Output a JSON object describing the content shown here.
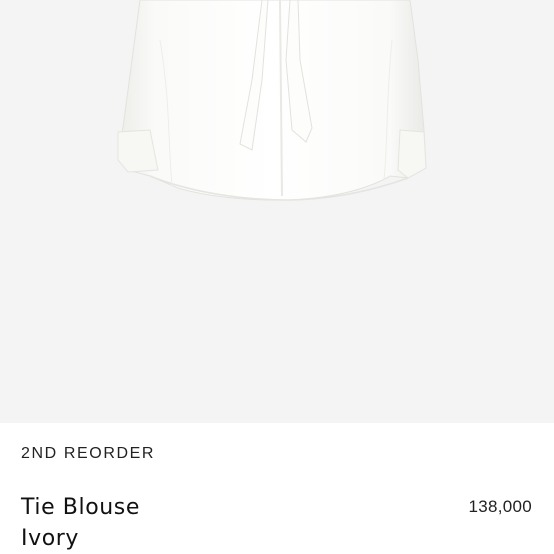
{
  "product": {
    "image_alt": "Ivory tie blouse on light grey background",
    "collection": "2ND REORDER",
    "name": "Tie Blouse",
    "color": "Ivory",
    "price": "138,000"
  },
  "colors": {
    "image_background": "#f4f4f4",
    "blouse": "#fbfbf9",
    "text": "#222222"
  }
}
